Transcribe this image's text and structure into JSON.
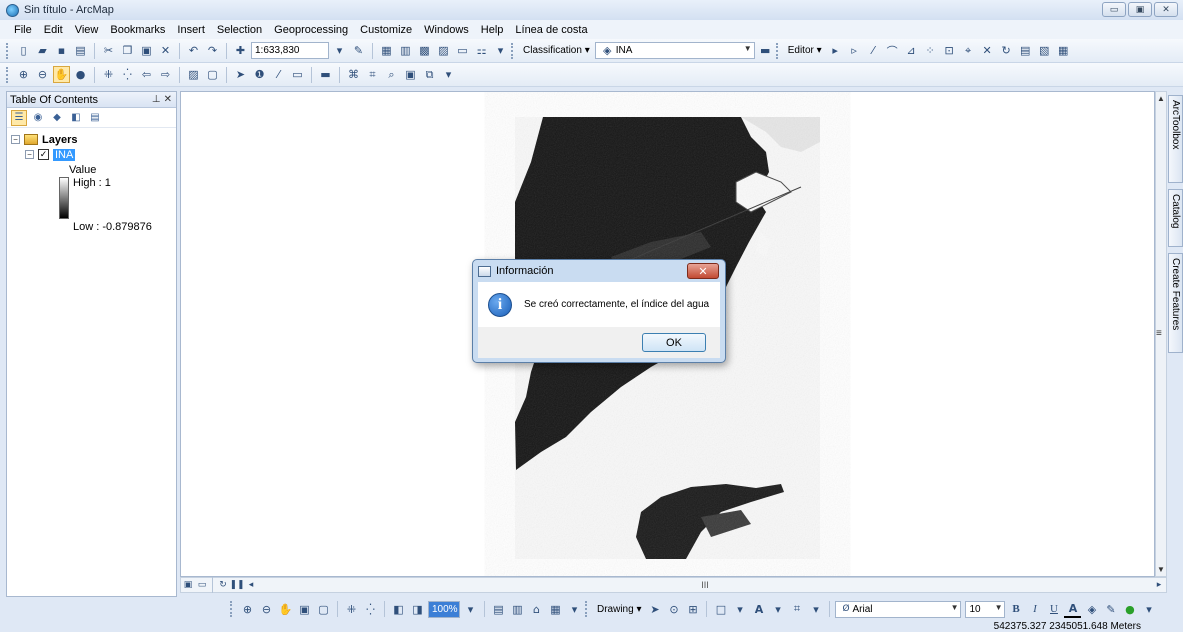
{
  "window": {
    "title": "Sin título - ArcMap",
    "buttons": {
      "minimize": "▭",
      "maximize": "▣",
      "close": "✕"
    }
  },
  "menubar": {
    "items": [
      "File",
      "Edit",
      "View",
      "Bookmarks",
      "Insert",
      "Selection",
      "Geoprocessing",
      "Customize",
      "Windows",
      "Help",
      "Línea de costa"
    ]
  },
  "toolbar1": {
    "scale": "1:633,830",
    "classification_label": "Classification ▾",
    "layer_combo": "INA",
    "editor_label": "Editor ▾"
  },
  "toc": {
    "title": "Table Of Contents",
    "root_label": "Layers",
    "layer_name": "INA",
    "legend_heading": "Value",
    "high_label": "High : 1",
    "low_label": "Low : -0.879876"
  },
  "drawing_toolbar": {
    "zoom_value": "100%",
    "drawing_label": "Drawing ▾",
    "font_name": "Arial",
    "font_size": "10",
    "bold": "B",
    "italic": "I",
    "underline": "U",
    "font_color_letter": "A"
  },
  "status": {
    "coordinates": "542375.327  2345051.648 Meters"
  },
  "side_tabs": [
    "ArcToolbox",
    "Catalog",
    "Create Features"
  ],
  "scrollbar": {
    "hscroll_grip": "III",
    "vscroll_grip": "≡"
  },
  "dialog": {
    "title": "Información",
    "message": "Se creó correctamente, el índice del agua",
    "ok_label": "OK",
    "close_glyph": "✕",
    "icon_glyph": "i"
  }
}
